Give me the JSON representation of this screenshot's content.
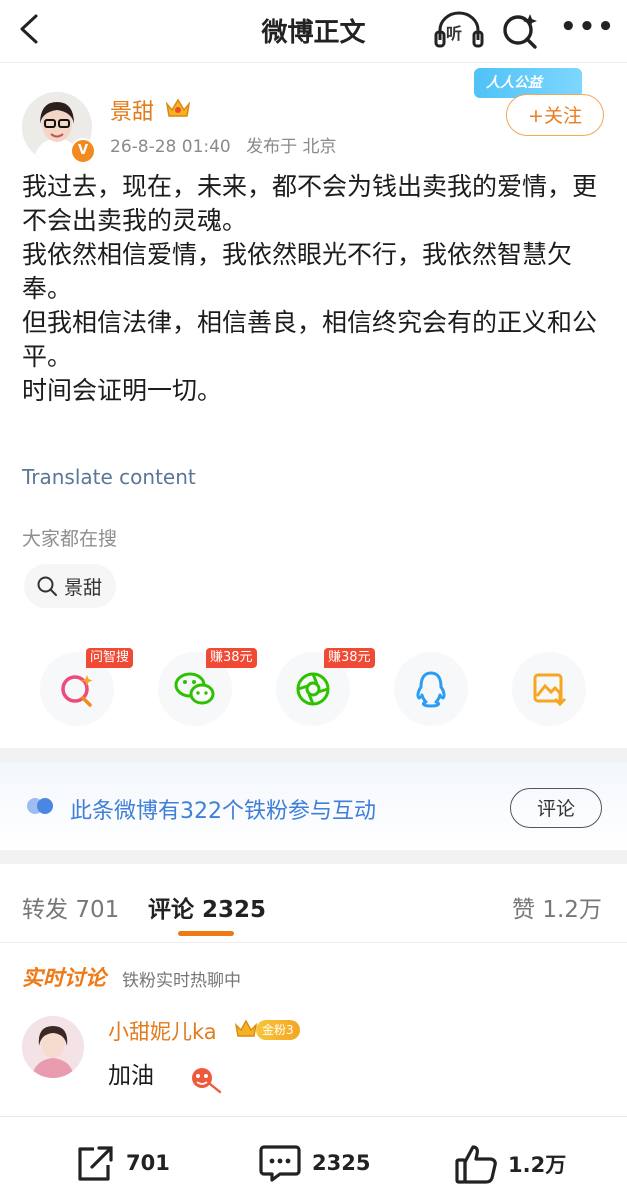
{
  "header": {
    "title": "微博正文",
    "listen_label": "听",
    "back_icon": "chevron-left-icon",
    "ai_icon": "ai-search-icon",
    "more_icon": "more-icon"
  },
  "post": {
    "author": "景甜",
    "date": "26-8-28 01:40",
    "location": "发布于 北京",
    "verified_badge": "V",
    "charity_label": "人人公益",
    "follow_label": "+关注",
    "body": [
      "我过去，现在，未来，都不会为钱出卖我的爱情，更不会出卖我的灵魂。",
      "我依然相信爱情，我依然眼光不行，我依然智慧欠奉。",
      "但我相信法律，相信善良，相信终究会有的正义和公平。",
      "时间会证明一切。"
    ],
    "translate": "Translate content"
  },
  "search": {
    "title": "大家都在搜",
    "chip": "景甜"
  },
  "share_row": [
    {
      "icon": "ai-search-icon",
      "badge": "问智搜"
    },
    {
      "icon": "wechat-icon",
      "badge": "赚38元"
    },
    {
      "icon": "moments-icon",
      "badge": "赚38元"
    },
    {
      "icon": "qq-icon",
      "badge": ""
    },
    {
      "icon": "save-image-icon",
      "badge": ""
    }
  ],
  "fans": {
    "text": "此条微博有322个铁粉参与互动",
    "button": "评论"
  },
  "tabs": {
    "repost": "转发",
    "repost_count": "701",
    "comments": "评论",
    "comments_count": "2325",
    "likes": "赞",
    "likes_count": "1.2万"
  },
  "realtime": {
    "title": "实时讨论",
    "subtitle": "铁粉实时热聊中"
  },
  "comment": {
    "name": "小甜妮儿ka",
    "fan_badge": "金粉3",
    "text": "加油"
  },
  "bottom": {
    "repost": "701",
    "comments": "2325",
    "likes": "1.2万"
  },
  "colors": {
    "accent": "#ee7a16",
    "link": "#5a7798",
    "fans_blue": "#3f7fd8"
  }
}
